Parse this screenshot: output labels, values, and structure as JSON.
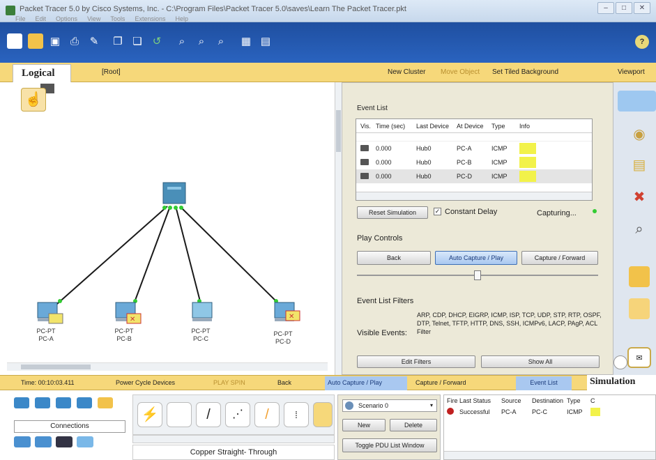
{
  "window": {
    "title": "Packet Tracer 5.0 by Cisco Systems, Inc. - C:\\Program Files\\Packet Tracer 5.0\\saves\\Learn The Packet Tracer.pkt",
    "menu": [
      "File",
      "Edit",
      "Options",
      "View",
      "Tools",
      "Extensions",
      "Help"
    ],
    "controls": [
      "–",
      "□",
      "✕"
    ]
  },
  "logical_bar": {
    "tab": "Logical",
    "root": "[Root]",
    "new_cluster": "New Cluster",
    "move_object": "Move Object",
    "set_tiled": "Set Tiled Background",
    "viewport": "Viewport"
  },
  "workspace": {
    "pcs": [
      {
        "type": "PC-PT",
        "name": "PC-A"
      },
      {
        "type": "PC-PT",
        "name": "PC-B"
      },
      {
        "type": "PC-PT",
        "name": "PC-C"
      },
      {
        "type": "PC-PT",
        "name": "PC-D"
      }
    ]
  },
  "simulation_panel": {
    "event_list_title": "Event List",
    "columns": [
      "Vis.",
      "Time (sec)",
      "Last Device",
      "At Device",
      "Type",
      "Info"
    ],
    "rows": [
      {
        "time": "0.000",
        "last": "Hub0",
        "at": "PC-A",
        "type": "ICMP",
        "selected": false
      },
      {
        "time": "0.000",
        "last": "Hub0",
        "at": "PC-B",
        "type": "ICMP",
        "selected": false
      },
      {
        "time": "0.000",
        "last": "Hub0",
        "at": "PC-D",
        "type": "ICMP",
        "selected": true
      }
    ],
    "reset_button": "Reset Simulation",
    "constant_delay": "Constant Delay",
    "capturing": "Capturing...",
    "play_controls": "Play Controls",
    "back_button": "Back",
    "auto_capture_button": "Auto Capture / Play",
    "capture_forward_button": "Capture / Forward",
    "slider_level": 0.5,
    "filters_title": "Event List Filters",
    "visible_events_label": "Visible Events:",
    "visible_events": "ARP, CDP, DHCP, EIGRP, ICMP, ISP, TCP, UDP, STP, RTP, OSPF, DTP, Telnet, TFTP, HTTP, DNS, SSH, ICMPv6, LACP, PAgP, ACL Filter",
    "edit_filters_button": "Edit Filters",
    "show_all_button": "Show All"
  },
  "bottom_strip": {
    "time": "Time: 00:10:03.411",
    "power_cycle": "Power Cycle Devices",
    "fast_forward": "PLAY SPIN",
    "back": "Back",
    "auto_capture": "Auto Capture / Play",
    "capture_forward": "Capture / Forward",
    "event_list": "Event List",
    "simulation": "Simulation"
  },
  "device_palette": {
    "connections_label": "Connections",
    "cable_label": "Copper Straight- Through"
  },
  "scenario": {
    "select": "Scenario 0",
    "new_button": "New",
    "delete_button": "Delete",
    "toggle_button": "Toggle PDU List Window"
  },
  "pdu_table": {
    "columns": [
      "Fire",
      "Last Status",
      "Source",
      "Destination",
      "Type",
      "C"
    ],
    "rows": [
      {
        "status": "Successful",
        "source": "PC-A",
        "destination": "PC-C",
        "type": "ICMP"
      }
    ]
  },
  "colors": {
    "toolbar": "#2a63bf",
    "status_bar": "#f6d87a",
    "link": "#1a1a1a",
    "link_endpoint": "#33cc33",
    "info_color": "#f2f24a"
  }
}
